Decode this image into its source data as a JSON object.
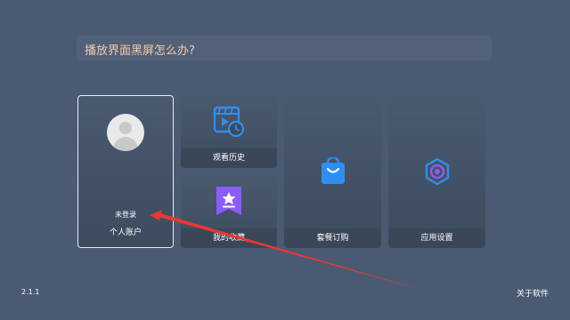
{
  "search": {
    "question": "播放界面黑屏怎么办?"
  },
  "cards": {
    "account": {
      "status": "未登录",
      "label": "个人账户",
      "icon": "avatar-icon"
    },
    "history": {
      "label": "观看历史",
      "icon": "history-icon"
    },
    "favorites": {
      "label": "我的收藏",
      "icon": "star-bookmark-icon"
    },
    "plan": {
      "label": "套餐订购",
      "icon": "shopping-bag-icon"
    },
    "settings": {
      "label": "应用设置",
      "icon": "gear-icon"
    }
  },
  "footer": {
    "version": "2.1.1",
    "about": "关于软件"
  },
  "colors": {
    "background": "#4a5a72",
    "accent_blue": "#2e8ff0",
    "accent_purple": "#8b5cf6",
    "annotation_arrow": "#e53935",
    "question_text": "#f3c9a8"
  }
}
